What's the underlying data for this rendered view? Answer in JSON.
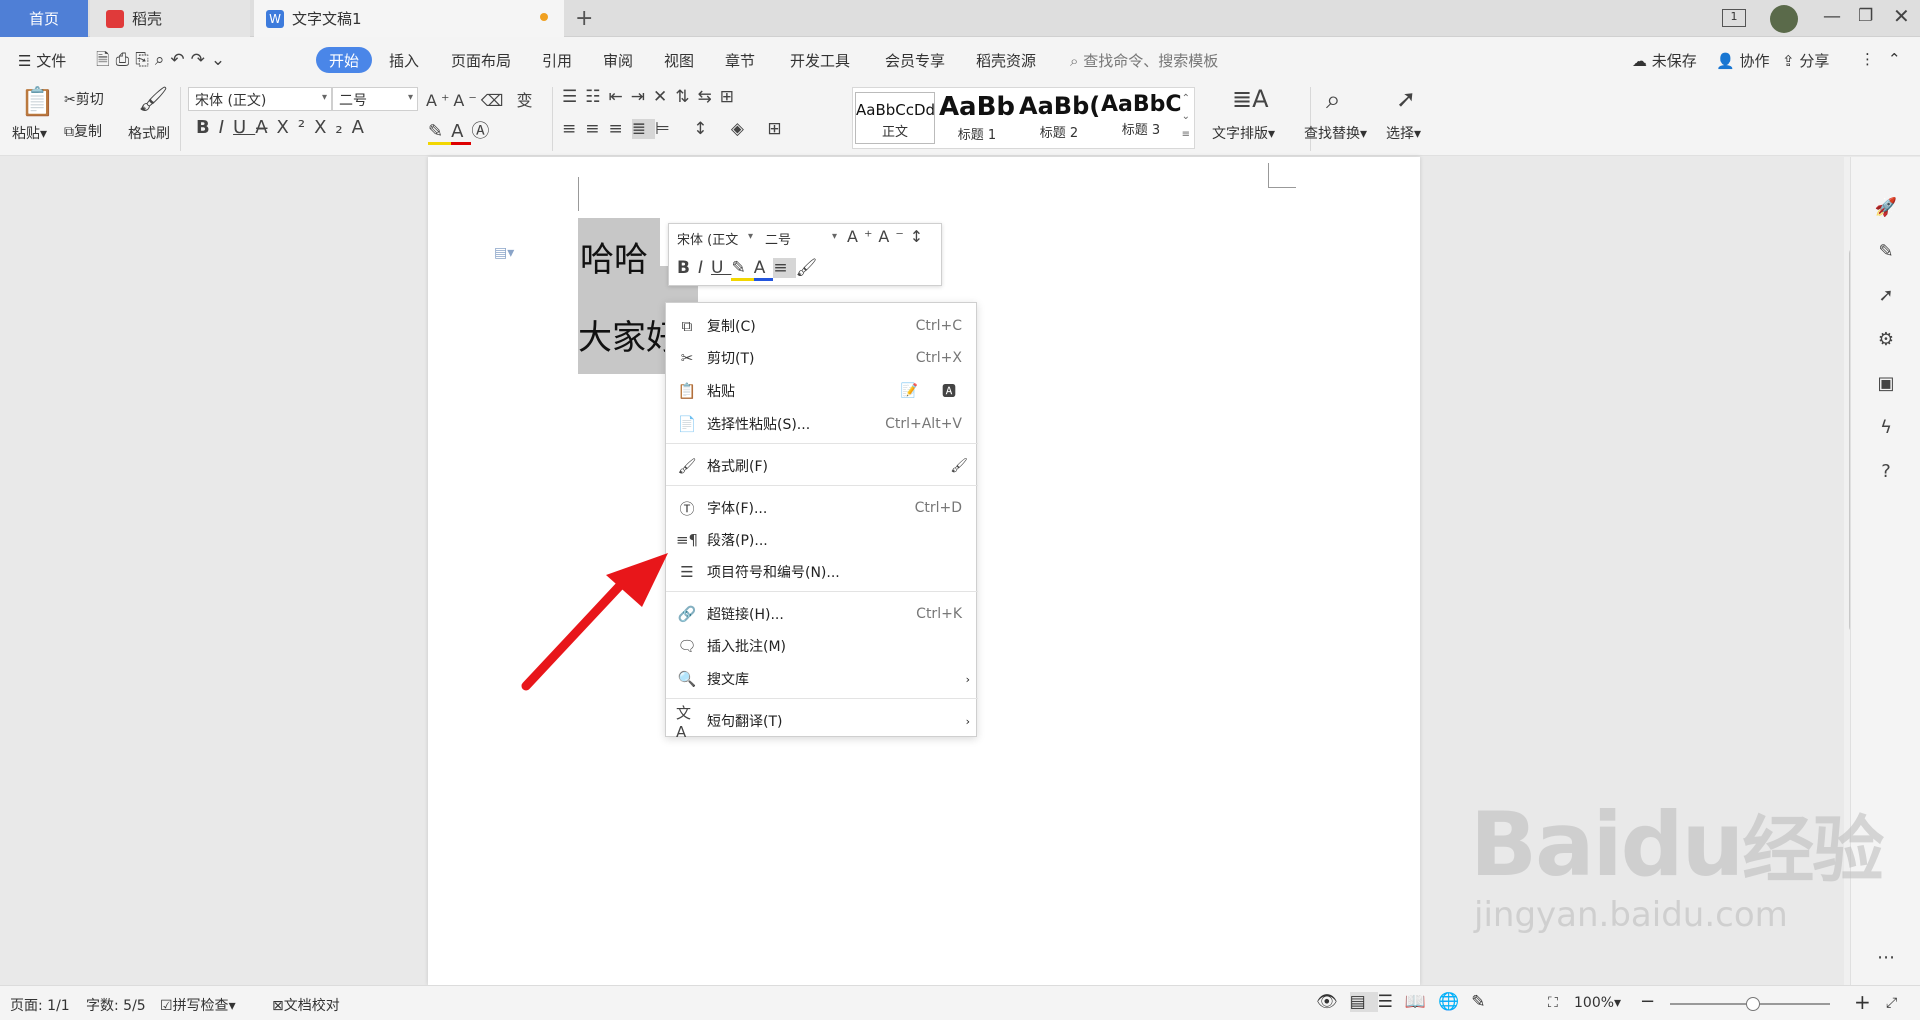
{
  "tabs": {
    "home": "首页",
    "daoke": "稻壳",
    "doc": "文字文稿1"
  },
  "menu": {
    "file": "文件",
    "items": [
      "开始",
      "插入",
      "页面布局",
      "引用",
      "审阅",
      "视图",
      "章节",
      "开发工具",
      "会员专享",
      "稻壳资源"
    ],
    "search": "查找命令、搜索模板",
    "unsaved": "未保存",
    "collab": "协作",
    "share": "分享"
  },
  "ribbon": {
    "paste": "粘贴",
    "cut": "剪切",
    "copy": "复制",
    "formatPainter": "格式刷",
    "font": "宋体 (正文)",
    "size": "二号",
    "styles": [
      {
        "preview": "AaBbCcDd",
        "name": "正文"
      },
      {
        "preview": "AaBb",
        "name": "标题 1"
      },
      {
        "preview": "AaBb(",
        "name": "标题 2"
      },
      {
        "preview": "AaBbC",
        "name": "标题 3"
      }
    ],
    "textLayout": "文字排版",
    "findReplace": "查找替换",
    "select": "选择"
  },
  "doc": {
    "line1": "哈哈",
    "line2": "大家好"
  },
  "mini": {
    "font": "宋体 (正文",
    "size": "二号"
  },
  "context": [
    {
      "icon": "copy-icon",
      "label": "复制(C)",
      "shortcut": "Ctrl+C"
    },
    {
      "icon": "cut-icon",
      "label": "剪切(T)",
      "shortcut": "Ctrl+X"
    },
    {
      "icon": "paste-icon",
      "label": "粘贴",
      "shortcut": ""
    },
    {
      "icon": "paste-special-icon",
      "label": "选择性粘贴(S)...",
      "shortcut": "Ctrl+Alt+V"
    },
    {
      "icon": "format-painter-icon",
      "label": "格式刷(F)",
      "shortcut": ""
    },
    {
      "icon": "font-icon",
      "label": "字体(F)...",
      "shortcut": "Ctrl+D"
    },
    {
      "icon": "paragraph-icon",
      "label": "段落(P)...",
      "shortcut": ""
    },
    {
      "icon": "bullets-icon",
      "label": "项目符号和编号(N)...",
      "shortcut": ""
    },
    {
      "icon": "link-icon",
      "label": "超链接(H)...",
      "shortcut": "Ctrl+K"
    },
    {
      "icon": "comment-icon",
      "label": "插入批注(M)",
      "shortcut": ""
    },
    {
      "icon": "search-library-icon",
      "label": "搜文库",
      "shortcut": ""
    },
    {
      "icon": "translate-icon",
      "label": "短句翻译(T)",
      "shortcut": ""
    }
  ],
  "status": {
    "page": "页面: 1/1",
    "words": "字数: 5/5",
    "spell": "拼写检查",
    "proof": "文档校对",
    "zoom": "100%"
  },
  "watermark": {
    "brand": "Bai",
    "mid": "du",
    "cn": "经验",
    "url": "jingyan.baidu.com"
  }
}
